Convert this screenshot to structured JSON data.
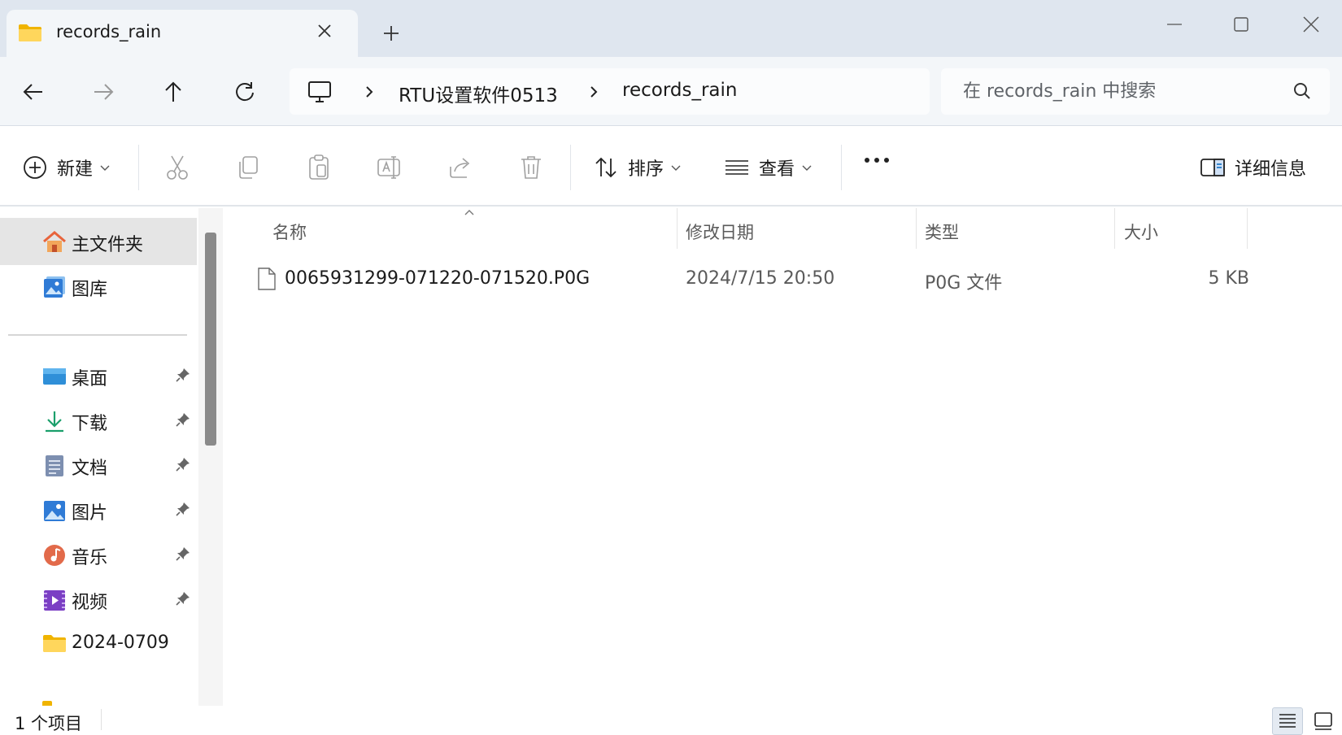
{
  "tab": {
    "title": "records_rain"
  },
  "address": {
    "crumbs": [
      "RTU设置软件0513",
      "records_rain"
    ]
  },
  "search": {
    "placeholder": "在 records_rain 中搜索"
  },
  "commands": {
    "new_label": "新建",
    "sort_label": "排序",
    "view_label": "查看",
    "details_label": "详细信息"
  },
  "sidebar": {
    "items": [
      {
        "label": "主文件夹",
        "icon": "home-icon",
        "active": true
      },
      {
        "label": "图库",
        "icon": "gallery-icon"
      },
      {
        "label": "桌面",
        "icon": "desktop-icon",
        "pinned": true
      },
      {
        "label": "下载",
        "icon": "download-icon",
        "pinned": true
      },
      {
        "label": "文档",
        "icon": "documents-icon",
        "pinned": true
      },
      {
        "label": "图片",
        "icon": "pictures-icon",
        "pinned": true
      },
      {
        "label": "音乐",
        "icon": "music-icon",
        "pinned": true
      },
      {
        "label": "视频",
        "icon": "videos-icon",
        "pinned": true
      },
      {
        "label": "2024-0709",
        "icon": "folder-icon"
      }
    ]
  },
  "columns": [
    "名称",
    "修改日期",
    "类型",
    "大小"
  ],
  "files": [
    {
      "name": "0065931299-071220-071520.P0G",
      "modified": "2024/7/15 20:50",
      "type": "P0G 文件",
      "size": "5 KB",
      "icon": "file-icon"
    }
  ],
  "status": {
    "count": "1 个项目"
  },
  "colors": {
    "accent": "#0067c0",
    "tabbar": "#dfe6ef",
    "navbar": "#f3f6f9",
    "selected": "#e5e5e5"
  }
}
